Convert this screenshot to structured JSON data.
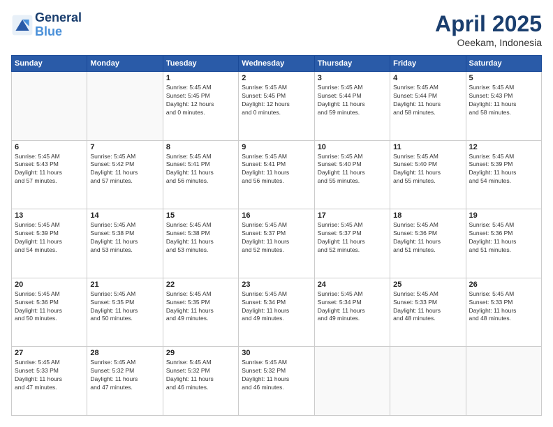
{
  "header": {
    "logo_line1": "General",
    "logo_line2": "Blue",
    "month": "April 2025",
    "location": "Oeekam, Indonesia"
  },
  "weekdays": [
    "Sunday",
    "Monday",
    "Tuesday",
    "Wednesday",
    "Thursday",
    "Friday",
    "Saturday"
  ],
  "weeks": [
    [
      {
        "day": "",
        "detail": ""
      },
      {
        "day": "",
        "detail": ""
      },
      {
        "day": "1",
        "detail": "Sunrise: 5:45 AM\nSunset: 5:45 PM\nDaylight: 12 hours\nand 0 minutes."
      },
      {
        "day": "2",
        "detail": "Sunrise: 5:45 AM\nSunset: 5:45 PM\nDaylight: 12 hours\nand 0 minutes."
      },
      {
        "day": "3",
        "detail": "Sunrise: 5:45 AM\nSunset: 5:44 PM\nDaylight: 11 hours\nand 59 minutes."
      },
      {
        "day": "4",
        "detail": "Sunrise: 5:45 AM\nSunset: 5:44 PM\nDaylight: 11 hours\nand 58 minutes."
      },
      {
        "day": "5",
        "detail": "Sunrise: 5:45 AM\nSunset: 5:43 PM\nDaylight: 11 hours\nand 58 minutes."
      }
    ],
    [
      {
        "day": "6",
        "detail": "Sunrise: 5:45 AM\nSunset: 5:43 PM\nDaylight: 11 hours\nand 57 minutes."
      },
      {
        "day": "7",
        "detail": "Sunrise: 5:45 AM\nSunset: 5:42 PM\nDaylight: 11 hours\nand 57 minutes."
      },
      {
        "day": "8",
        "detail": "Sunrise: 5:45 AM\nSunset: 5:41 PM\nDaylight: 11 hours\nand 56 minutes."
      },
      {
        "day": "9",
        "detail": "Sunrise: 5:45 AM\nSunset: 5:41 PM\nDaylight: 11 hours\nand 56 minutes."
      },
      {
        "day": "10",
        "detail": "Sunrise: 5:45 AM\nSunset: 5:40 PM\nDaylight: 11 hours\nand 55 minutes."
      },
      {
        "day": "11",
        "detail": "Sunrise: 5:45 AM\nSunset: 5:40 PM\nDaylight: 11 hours\nand 55 minutes."
      },
      {
        "day": "12",
        "detail": "Sunrise: 5:45 AM\nSunset: 5:39 PM\nDaylight: 11 hours\nand 54 minutes."
      }
    ],
    [
      {
        "day": "13",
        "detail": "Sunrise: 5:45 AM\nSunset: 5:39 PM\nDaylight: 11 hours\nand 54 minutes."
      },
      {
        "day": "14",
        "detail": "Sunrise: 5:45 AM\nSunset: 5:38 PM\nDaylight: 11 hours\nand 53 minutes."
      },
      {
        "day": "15",
        "detail": "Sunrise: 5:45 AM\nSunset: 5:38 PM\nDaylight: 11 hours\nand 53 minutes."
      },
      {
        "day": "16",
        "detail": "Sunrise: 5:45 AM\nSunset: 5:37 PM\nDaylight: 11 hours\nand 52 minutes."
      },
      {
        "day": "17",
        "detail": "Sunrise: 5:45 AM\nSunset: 5:37 PM\nDaylight: 11 hours\nand 52 minutes."
      },
      {
        "day": "18",
        "detail": "Sunrise: 5:45 AM\nSunset: 5:36 PM\nDaylight: 11 hours\nand 51 minutes."
      },
      {
        "day": "19",
        "detail": "Sunrise: 5:45 AM\nSunset: 5:36 PM\nDaylight: 11 hours\nand 51 minutes."
      }
    ],
    [
      {
        "day": "20",
        "detail": "Sunrise: 5:45 AM\nSunset: 5:36 PM\nDaylight: 11 hours\nand 50 minutes."
      },
      {
        "day": "21",
        "detail": "Sunrise: 5:45 AM\nSunset: 5:35 PM\nDaylight: 11 hours\nand 50 minutes."
      },
      {
        "day": "22",
        "detail": "Sunrise: 5:45 AM\nSunset: 5:35 PM\nDaylight: 11 hours\nand 49 minutes."
      },
      {
        "day": "23",
        "detail": "Sunrise: 5:45 AM\nSunset: 5:34 PM\nDaylight: 11 hours\nand 49 minutes."
      },
      {
        "day": "24",
        "detail": "Sunrise: 5:45 AM\nSunset: 5:34 PM\nDaylight: 11 hours\nand 49 minutes."
      },
      {
        "day": "25",
        "detail": "Sunrise: 5:45 AM\nSunset: 5:33 PM\nDaylight: 11 hours\nand 48 minutes."
      },
      {
        "day": "26",
        "detail": "Sunrise: 5:45 AM\nSunset: 5:33 PM\nDaylight: 11 hours\nand 48 minutes."
      }
    ],
    [
      {
        "day": "27",
        "detail": "Sunrise: 5:45 AM\nSunset: 5:33 PM\nDaylight: 11 hours\nand 47 minutes."
      },
      {
        "day": "28",
        "detail": "Sunrise: 5:45 AM\nSunset: 5:32 PM\nDaylight: 11 hours\nand 47 minutes."
      },
      {
        "day": "29",
        "detail": "Sunrise: 5:45 AM\nSunset: 5:32 PM\nDaylight: 11 hours\nand 46 minutes."
      },
      {
        "day": "30",
        "detail": "Sunrise: 5:45 AM\nSunset: 5:32 PM\nDaylight: 11 hours\nand 46 minutes."
      },
      {
        "day": "",
        "detail": ""
      },
      {
        "day": "",
        "detail": ""
      },
      {
        "day": "",
        "detail": ""
      }
    ]
  ]
}
